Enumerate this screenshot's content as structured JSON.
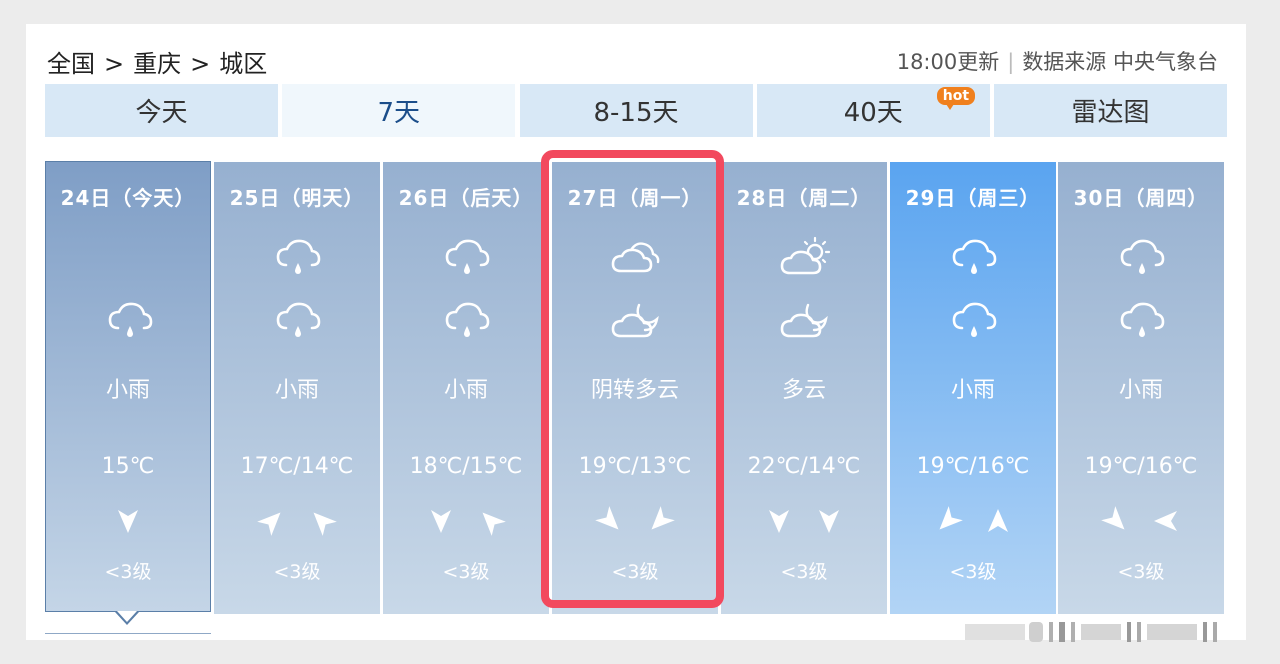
{
  "breadcrumb": [
    "全国",
    "重庆",
    "城区"
  ],
  "breadcrumb_separator": ">",
  "header": {
    "update_time": "18:00更新",
    "source_label": "数据来源",
    "source_name": "中央气象台"
  },
  "tabs": [
    {
      "label": "今天"
    },
    {
      "label": "7天",
      "active": true
    },
    {
      "label": "8-15天"
    },
    {
      "label": "40天",
      "badge": "hot"
    },
    {
      "label": "雷达图"
    }
  ],
  "days": [
    {
      "date": "24日（今天）",
      "icons": [
        "rain-icon"
      ],
      "desc": "小雨",
      "temp": "15℃",
      "wind_icons": [
        "wind-arrow-down-icon"
      ],
      "wind_level": "<3级"
    },
    {
      "date": "25日（明天）",
      "icons": [
        "rain-icon",
        "rain-icon"
      ],
      "desc": "小雨",
      "temp": "17℃/14℃",
      "wind_icons": [
        "wind-arrow-northeast-icon",
        "wind-arrow-northwest-icon"
      ],
      "wind_level": "<3级"
    },
    {
      "date": "26日（后天）",
      "icons": [
        "rain-icon",
        "rain-icon"
      ],
      "desc": "小雨",
      "temp": "18℃/15℃",
      "wind_icons": [
        "wind-arrow-down-icon",
        "wind-arrow-northwest-icon"
      ],
      "wind_level": "<3级"
    },
    {
      "date": "27日（周一）",
      "icons": [
        "overcast-icon",
        "cloudy-night-icon"
      ],
      "desc": "阴转多云",
      "temp": "19℃/13℃",
      "wind_icons": [
        "wind-arrow-southeast-icon",
        "wind-arrow-southwest-icon"
      ],
      "wind_level": "<3级"
    },
    {
      "date": "28日（周二）",
      "icons": [
        "partly-cloudy-day-icon",
        "cloudy-night-icon"
      ],
      "desc": "多云",
      "temp": "22℃/14℃",
      "wind_icons": [
        "wind-arrow-down-icon",
        "wind-arrow-down-icon"
      ],
      "wind_level": "<3级"
    },
    {
      "date": "29日（周三）",
      "icons": [
        "rain-icon",
        "rain-icon"
      ],
      "desc": "小雨",
      "temp": "19℃/16℃",
      "wind_icons": [
        "wind-arrow-southwest-icon",
        "wind-arrow-up-icon"
      ],
      "wind_level": "<3级"
    },
    {
      "date": "30日（周四）",
      "icons": [
        "rain-icon",
        "rain-icon"
      ],
      "desc": "小雨",
      "temp": "19℃/16℃",
      "wind_icons": [
        "wind-arrow-southeast-icon",
        "wind-arrow-left-icon"
      ],
      "wind_level": "<3级"
    }
  ],
  "colors": {
    "tab_bg": "#d8e8f6",
    "active_tab_text": "#1c4e8a",
    "card_bg": "#96b0d0",
    "highlight_card_bg": "#5aa4f0",
    "red_frame": "#f2495e",
    "hot_badge": "#f0801e"
  }
}
